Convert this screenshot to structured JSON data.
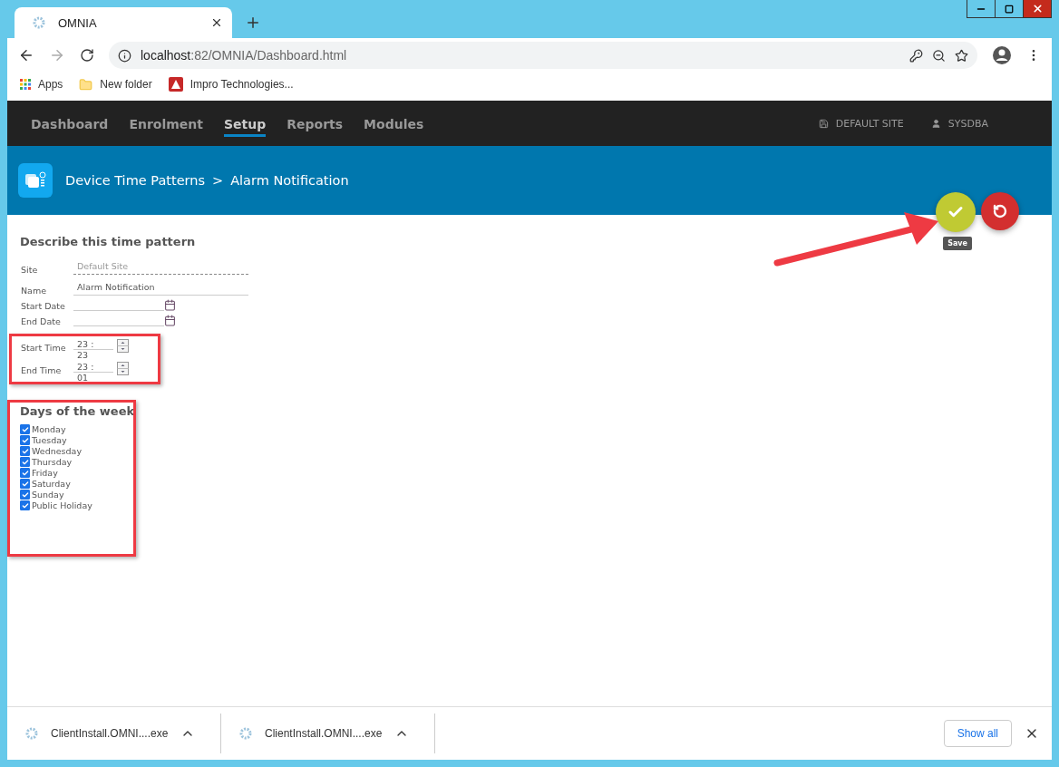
{
  "browser": {
    "tab_title": "OMNIA",
    "url_host": "localhost",
    "url_path": ":82/OMNIA/Dashboard.html"
  },
  "bookmarks": [
    {
      "kind": "apps",
      "label": "Apps"
    },
    {
      "kind": "folder",
      "label": "New folder"
    },
    {
      "kind": "site",
      "label": "Impro Technologies..."
    }
  ],
  "nav": {
    "items": [
      {
        "label": "Dashboard",
        "selected": false
      },
      {
        "label": "Enrolment",
        "selected": false
      },
      {
        "label": "Setup",
        "selected": true
      },
      {
        "label": "Reports",
        "selected": false
      },
      {
        "label": "Modules",
        "selected": false
      }
    ],
    "site": "DEFAULT SITE",
    "user": "SYSDBA"
  },
  "header": {
    "breadcrumb": "Device Time Patterns",
    "separator": ">",
    "current": "Alarm Notification"
  },
  "actions": {
    "save_tooltip": "Save"
  },
  "form": {
    "title": "Describe this time pattern",
    "fields": [
      {
        "kind": "readonly",
        "label": "Site",
        "value": "Default Site"
      },
      {
        "kind": "text",
        "label": "Name",
        "value": "Alarm Notification"
      },
      {
        "kind": "date",
        "label": "Start Date"
      },
      {
        "kind": "date",
        "label": "End Date"
      }
    ],
    "times": [
      {
        "label": "Start Time",
        "hour": "23",
        "sep": ":",
        "minute": "23"
      },
      {
        "label": "End Time",
        "hour": "23",
        "sep": ":",
        "minute": "01"
      }
    ]
  },
  "days": {
    "title": "Days of the week",
    "items": [
      {
        "label": "Monday",
        "checked": true
      },
      {
        "label": "Tuesday",
        "checked": true
      },
      {
        "label": "Wednesday",
        "checked": true
      },
      {
        "label": "Thursday",
        "checked": true
      },
      {
        "label": "Friday",
        "checked": true
      },
      {
        "label": "Saturday",
        "checked": true
      },
      {
        "label": "Sunday",
        "checked": true
      },
      {
        "label": "Public Holiday",
        "checked": true
      }
    ]
  },
  "downloads": {
    "items": [
      {
        "name": "ClientInstall.OMNI....exe"
      },
      {
        "name": "ClientInstall.OMNI....exe"
      }
    ],
    "show_all": "Show all"
  }
}
